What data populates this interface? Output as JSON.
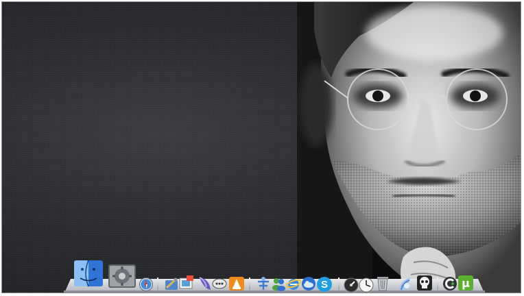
{
  "desktop": {
    "wallpaper": "portrait-wallpaper",
    "background_color": "#2b2c30"
  },
  "dock": {
    "items": [
      {
        "icon": "finder-icon"
      },
      {
        "icon": "system-preferences-icon"
      },
      {
        "icon": "safari-icon"
      },
      {
        "icon": "utilities-icon"
      },
      {
        "icon": "preview-icon"
      },
      {
        "icon": "app-launcher-icon"
      },
      {
        "icon": "messages-icon"
      },
      {
        "icon": "vlc-icon"
      },
      {
        "icon": "network-icon"
      },
      {
        "icon": "messenger-icon"
      },
      {
        "icon": "internet-explorer-icon"
      },
      {
        "icon": "cloud-icon"
      },
      {
        "icon": "skype-icon"
      },
      {
        "icon": "dashboard-icon"
      },
      {
        "icon": "clock-icon"
      },
      {
        "icon": "trash-icon"
      },
      {
        "icon": "flower-icon"
      },
      {
        "icon": "skull-icon"
      },
      {
        "icon": "ccleaner-icon"
      },
      {
        "icon": "utorrent-icon"
      }
    ],
    "colors": {
      "shelf": "#cfd2d6",
      "skype": "#1fa0e6",
      "utorrent": "#5bb12f",
      "vlc": "#f08a1c"
    }
  }
}
